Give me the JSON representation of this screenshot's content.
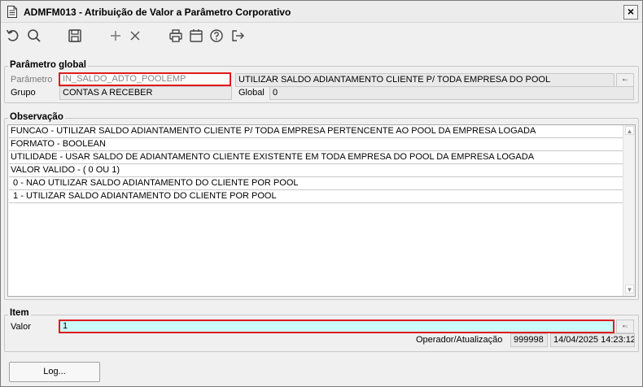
{
  "window": {
    "title": "ADMFM013 - Atribuição de Valor a Parâmetro Corporativo",
    "close_label": "×"
  },
  "toolbar": {
    "icons": [
      "undo-icon",
      "search-icon",
      "save-icon",
      "add-icon",
      "delete-icon",
      "print-icon",
      "calendar-icon",
      "help-icon",
      "exit-icon"
    ]
  },
  "global": {
    "section_title": "Parâmetro global",
    "parametro_label": "Parâmetro",
    "parametro_value": "IN_SALDO_ADTO_POOLEMP",
    "parametro_desc": "UTILIZAR SALDO ADIANTAMENTO CLIENTE P/ TODA EMPRESA DO POOL",
    "grupo_label": "Grupo",
    "grupo_value": "CONTAS A RECEBER",
    "global_label": "Global",
    "global_value": "0"
  },
  "observacao": {
    "section_title": "Observação",
    "lines": [
      "FUNCAO - UTILIZAR SALDO ADIANTAMENTO CLIENTE P/ TODA EMPRESA PERTENCENTE AO POOL DA EMPRESA LOGADA",
      "FORMATO - BOOLEAN",
      "UTILIDADE - USAR SALDO DE ADIANTAMENTO CLIENTE EXISTENTE EM TODA EMPRESA DO POOL DA EMPRESA LOGADA",
      "VALOR VALIDO -  ( 0 OU 1)",
      " 0 - NAO UTILIZAR SALDO ADIANTAMENTO DO CLIENTE POR POOL",
      " 1 - UTILIZAR SALDO ADIANTAMENTO DO CLIENTE POR POOL"
    ]
  },
  "item": {
    "section_title": "Item",
    "valor_label": "Valor",
    "valor_value": "1",
    "operador_label": "Operador/Atualização",
    "operador_value": "999998",
    "atualizacao_value": "14/04/2025 14:23:12"
  },
  "footer": {
    "log_label": "Log..."
  }
}
